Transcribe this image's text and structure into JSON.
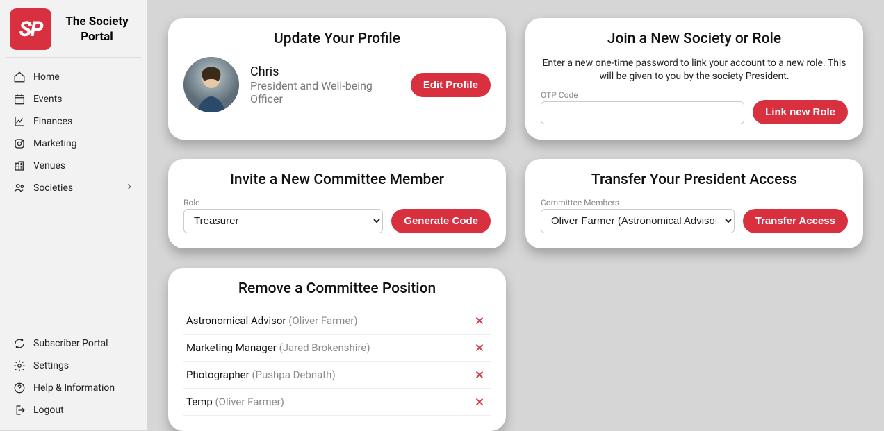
{
  "brand": {
    "logo_text": "SP",
    "title": "The Society Portal"
  },
  "sidebar": {
    "nav": [
      {
        "label": "Home"
      },
      {
        "label": "Events"
      },
      {
        "label": "Finances"
      },
      {
        "label": "Marketing"
      },
      {
        "label": "Venues"
      },
      {
        "label": "Societies",
        "has_submenu": true
      }
    ],
    "bottom": [
      {
        "label": "Subscriber Portal"
      },
      {
        "label": "Settings"
      },
      {
        "label": "Help & Information"
      },
      {
        "label": "Logout"
      }
    ]
  },
  "profile": {
    "title": "Update Your Profile",
    "name": "Chris",
    "role": "President and Well-being Officer",
    "edit_button": "Edit Profile"
  },
  "join": {
    "title": "Join a New Society or Role",
    "subtext": "Enter a new one-time password to link your account to a new role. This will be given to you by the society President.",
    "otp_label": "OTP Code",
    "otp_value": "",
    "button": "Link new Role"
  },
  "invite": {
    "title": "Invite a New Committee Member",
    "role_label": "Role",
    "selected_role": "Treasurer",
    "button": "Generate Code"
  },
  "transfer": {
    "title": "Transfer Your President Access",
    "members_label": "Committee Members",
    "selected_member": "Oliver Farmer (Astronomical Advisor)",
    "button": "Transfer Access"
  },
  "remove": {
    "title": "Remove a Committee Position",
    "positions": [
      {
        "role": "Astronomical Advisor",
        "person": "(Oliver Farmer)"
      },
      {
        "role": "Marketing Manager",
        "person": "(Jared Brokenshire)"
      },
      {
        "role": "Photographer",
        "person": "(Pushpa Debnath)"
      },
      {
        "role": "Temp",
        "person": "(Oliver Farmer)"
      }
    ]
  }
}
